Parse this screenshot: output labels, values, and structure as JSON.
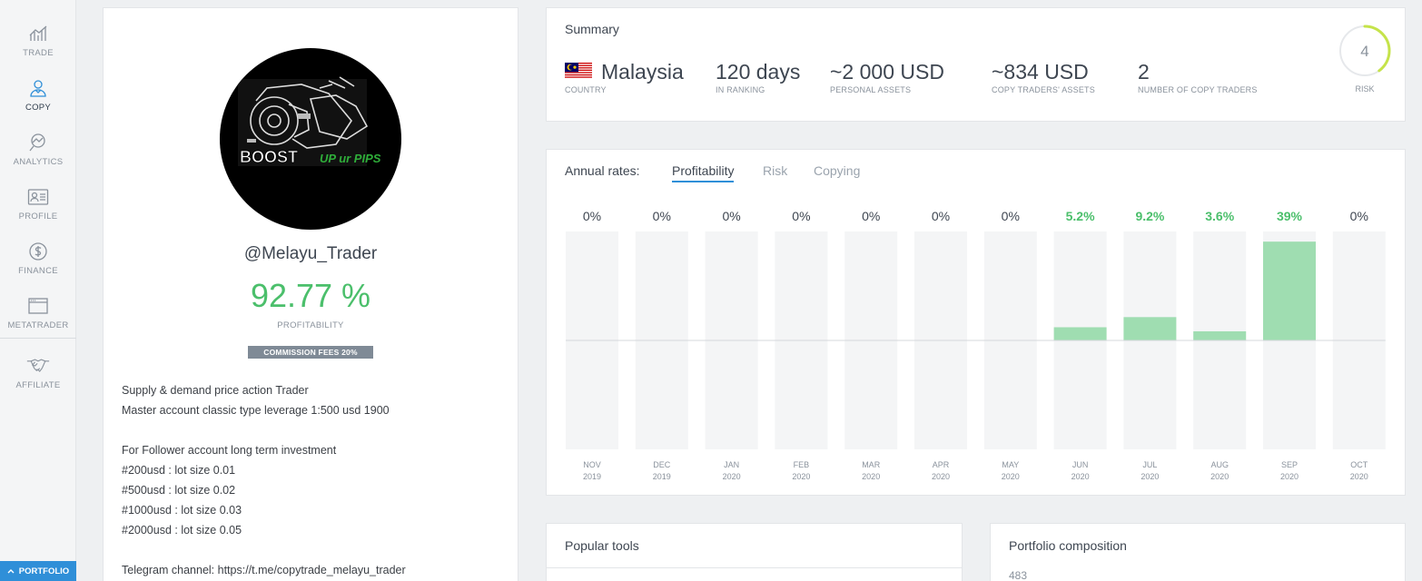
{
  "sidebar": {
    "items": [
      {
        "label": "TRADE",
        "icon": "chart-trade-icon"
      },
      {
        "label": "COPY",
        "icon": "user-copy-icon"
      },
      {
        "label": "ANALYTICS",
        "icon": "analytics-magnifier-icon"
      },
      {
        "label": "PROFILE",
        "icon": "profile-card-icon"
      },
      {
        "label": "FINANCE",
        "icon": "dollar-circle-icon"
      },
      {
        "label": "METATRADER",
        "icon": "window-icon"
      },
      {
        "label": "AFFILIATE",
        "icon": "handshake-icon"
      }
    ],
    "active": "COPY",
    "portfolio_label": "PORTFOLIO"
  },
  "profile": {
    "avatar_text": "BOOST",
    "avatar_subtext": "UP ur PIPS",
    "username": "@Melayu_Trader",
    "profitability_value": "92.77 %",
    "profitability_label": "PROFITABILITY",
    "commission_badge": "COMMISSION FEES 20%",
    "bio": [
      "Supply & demand price action Trader",
      "Master account classic type leverage 1:500 usd 1900",
      "",
      "For Follower account long term investment",
      "#200usd : lot size 0.01",
      "#500usd : lot size 0.02",
      "#1000usd : lot size 0.03",
      "#2000usd : lot size 0.05",
      "",
      "Telegram channel: https://t.me/copytrade_melayu_trader"
    ]
  },
  "summary": {
    "title": "Summary",
    "country": {
      "value": "Malaysia",
      "label": "COUNTRY"
    },
    "ranking": {
      "value": "120 days",
      "label": "IN RANKING"
    },
    "personal_assets": {
      "value": "~2 000 USD",
      "label": "PERSONAL ASSETS"
    },
    "copy_assets": {
      "value": "~834 USD",
      "label": "COPY TRADERS' ASSETS"
    },
    "copy_traders": {
      "value": "2",
      "label": "NUMBER OF COPY TRADERS"
    },
    "risk": {
      "value": "4",
      "label": "RISK",
      "level_fraction": 0.4,
      "color": "#c5e34a"
    }
  },
  "annual_rates": {
    "label": "Annual rates:",
    "tabs": [
      "Profitability",
      "Risk",
      "Copying"
    ],
    "active_tab": "Profitability"
  },
  "chart_data": {
    "type": "bar",
    "categories": [
      {
        "month": "NOV",
        "year": "2019"
      },
      {
        "month": "DEC",
        "year": "2019"
      },
      {
        "month": "JAN",
        "year": "2020"
      },
      {
        "month": "FEB",
        "year": "2020"
      },
      {
        "month": "MAR",
        "year": "2020"
      },
      {
        "month": "APR",
        "year": "2020"
      },
      {
        "month": "MAY",
        "year": "2020"
      },
      {
        "month": "JUN",
        "year": "2020"
      },
      {
        "month": "JUL",
        "year": "2020"
      },
      {
        "month": "AUG",
        "year": "2020"
      },
      {
        "month": "SEP",
        "year": "2020"
      },
      {
        "month": "OCT",
        "year": "2020"
      }
    ],
    "values": [
      0,
      0,
      0,
      0,
      0,
      0,
      0,
      5.2,
      9.2,
      3.6,
      39,
      0
    ],
    "value_labels": [
      "0%",
      "0%",
      "0%",
      "0%",
      "0%",
      "0%",
      "0%",
      "5.2%",
      "9.2%",
      "3.6%",
      "39%",
      "0%"
    ],
    "ylim": [
      -43,
      43
    ],
    "colors": {
      "positive": "#9fddb1",
      "positive_label": "#4bbf6b",
      "zero_label": "#3e4651",
      "track": "#f4f5f6",
      "axis": "#d5d8dc"
    }
  },
  "bottom": {
    "popular_tools": {
      "title": "Popular tools"
    },
    "portfolio": {
      "title": "Portfolio composition",
      "first_value": "483"
    }
  }
}
